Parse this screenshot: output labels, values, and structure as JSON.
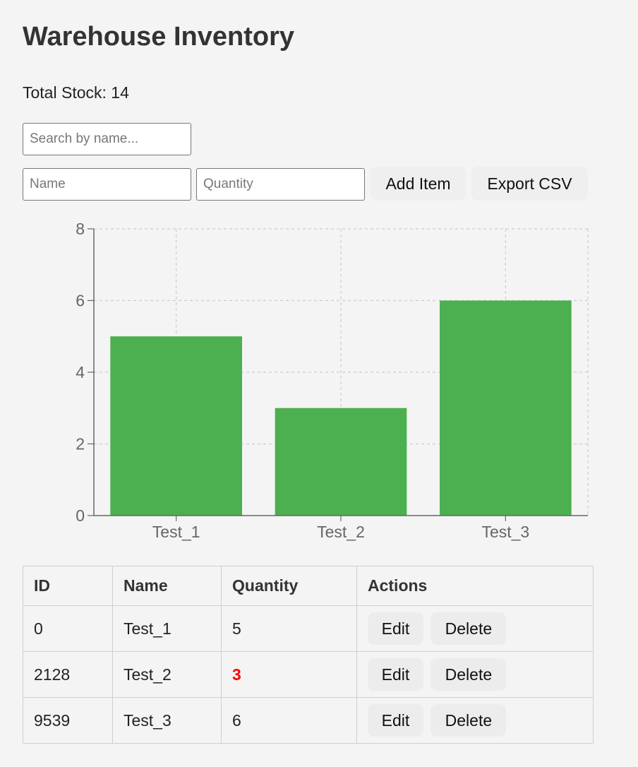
{
  "header": {
    "title": "Warehouse Inventory"
  },
  "summary": {
    "total_label": "Total Stock: 14"
  },
  "search": {
    "placeholder": "Search by name..."
  },
  "form": {
    "name_placeholder": "Name",
    "quantity_placeholder": "Quantity",
    "add_label": "Add Item",
    "export_label": "Export CSV"
  },
  "chart_data": {
    "type": "bar",
    "categories": [
      "Test_1",
      "Test_2",
      "Test_3"
    ],
    "values": [
      5,
      3,
      6
    ],
    "ylim": [
      0,
      8
    ],
    "yticks": [
      0,
      2,
      4,
      6,
      8
    ],
    "grid": true,
    "bar_color": "#4caf50"
  },
  "table": {
    "headers": [
      "ID",
      "Name",
      "Quantity",
      "Actions"
    ],
    "rows": [
      {
        "id": "0",
        "name": "Test_1",
        "quantity": "5",
        "low": false
      },
      {
        "id": "2128",
        "name": "Test_2",
        "quantity": "3",
        "low": true
      },
      {
        "id": "9539",
        "name": "Test_3",
        "quantity": "6",
        "low": false
      }
    ],
    "edit_label": "Edit",
    "delete_label": "Delete",
    "low_stock_color": "#ff0000"
  }
}
